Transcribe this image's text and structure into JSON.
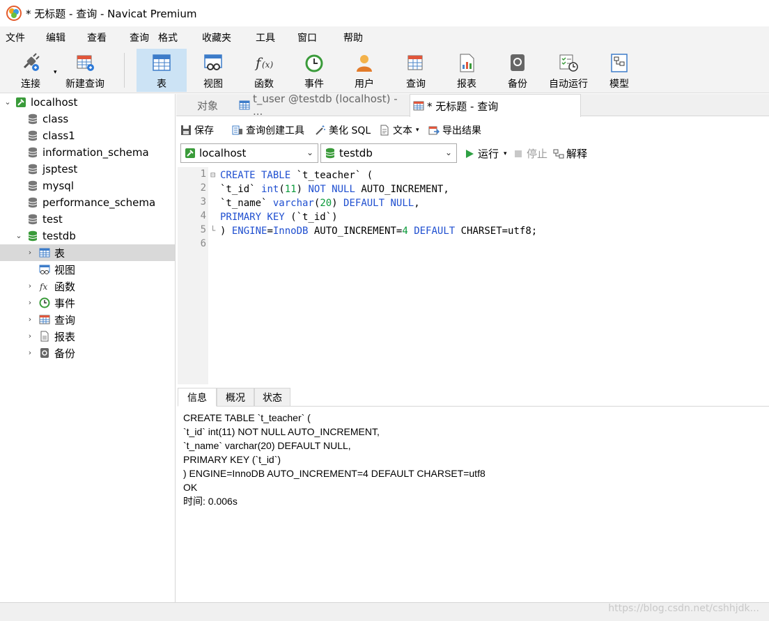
{
  "window": {
    "title": "* 无标题 - 查询 - Navicat Premium"
  },
  "menu": [
    "文件",
    "编辑",
    "查看",
    "查询",
    "格式",
    "收藏夹",
    "工具",
    "窗口",
    "帮助"
  ],
  "toolbar": {
    "connect": "连接",
    "new_query": "新建查询",
    "table": "表",
    "view": "视图",
    "function": "函数",
    "event": "事件",
    "user": "用户",
    "query": "查询",
    "report": "报表",
    "backup": "备份",
    "automation": "自动运行",
    "model": "模型"
  },
  "tree": {
    "connection": "localhost",
    "databases": [
      "class",
      "class1",
      "information_schema",
      "jsptest",
      "mysql",
      "performance_schema",
      "test",
      "testdb"
    ],
    "testdb_children": [
      "表",
      "视图",
      "函数",
      "事件",
      "查询",
      "报表",
      "备份"
    ]
  },
  "tabs": {
    "objects": "对象",
    "t_user": "t_user @testdb (localhost) - ...",
    "untitled": "* 无标题 - 查询"
  },
  "query_toolbar": {
    "save": "保存",
    "builder": "查询创建工具",
    "beautify": "美化 SQL",
    "text": "文本",
    "export": "导出结果"
  },
  "selectors": {
    "connection": "localhost",
    "database": "testdb"
  },
  "run_bar": {
    "run": "运行",
    "stop": "停止",
    "explain": "解释"
  },
  "editor": {
    "line_numbers": [
      "1",
      "2",
      "3",
      "4",
      "5",
      "6"
    ],
    "lines": [
      [
        {
          "t": "CREATE TABLE ",
          "c": "kw"
        },
        {
          "t": "`t_teacher` (",
          "c": "plain"
        }
      ],
      [
        {
          "t": "`t_id` ",
          "c": "plain"
        },
        {
          "t": "int",
          "c": "kw"
        },
        {
          "t": "(",
          "c": "plain"
        },
        {
          "t": "11",
          "c": "num"
        },
        {
          "t": ") ",
          "c": "plain"
        },
        {
          "t": "NOT NULL",
          "c": "kw"
        },
        {
          "t": " AUTO_INCREMENT,",
          "c": "plain"
        }
      ],
      [
        {
          "t": "`t_name` ",
          "c": "plain"
        },
        {
          "t": "varchar",
          "c": "kw"
        },
        {
          "t": "(",
          "c": "plain"
        },
        {
          "t": "20",
          "c": "num"
        },
        {
          "t": ") ",
          "c": "plain"
        },
        {
          "t": "DEFAULT NULL",
          "c": "kw"
        },
        {
          "t": ",",
          "c": "plain"
        }
      ],
      [
        {
          "t": "PRIMARY KEY",
          "c": "kw"
        },
        {
          "t": " (`t_id`)",
          "c": "plain"
        }
      ],
      [
        {
          "t": ") ",
          "c": "plain"
        },
        {
          "t": "ENGINE",
          "c": "kw"
        },
        {
          "t": "=",
          "c": "plain"
        },
        {
          "t": "InnoDB",
          "c": "kw"
        },
        {
          "t": " AUTO_INCREMENT=",
          "c": "plain"
        },
        {
          "t": "4",
          "c": "num"
        },
        {
          "t": " ",
          "c": "plain"
        },
        {
          "t": "DEFAULT",
          "c": "kw"
        },
        {
          "t": " CHARSET=utf8;",
          "c": "plain"
        }
      ],
      []
    ]
  },
  "result": {
    "tabs": [
      "信息",
      "概况",
      "状态"
    ],
    "lines": [
      "CREATE TABLE `t_teacher` (",
      "`t_id` int(11) NOT NULL AUTO_INCREMENT,",
      "`t_name` varchar(20) DEFAULT NULL,",
      "PRIMARY KEY (`t_id`)",
      ") ENGINE=InnoDB AUTO_INCREMENT=4 DEFAULT CHARSET=utf8",
      "OK",
      "时间: 0.006s"
    ]
  },
  "watermark": "https://blog.csdn.net/cshhjdk..."
}
